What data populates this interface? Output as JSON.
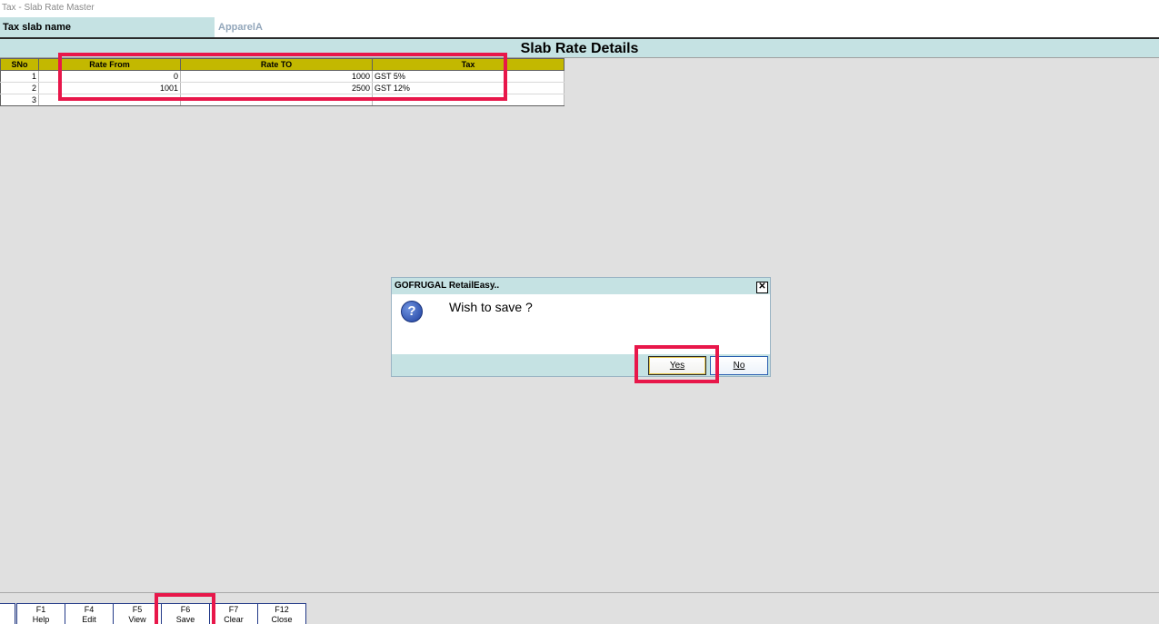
{
  "window": {
    "title": "Tax - Slab Rate Master"
  },
  "slab": {
    "label": "Tax slab name",
    "value": "ApparelA"
  },
  "section": {
    "title": "Slab Rate Details"
  },
  "grid": {
    "headers": {
      "sno": "SNo",
      "rate_from": "Rate From",
      "rate_to": "Rate TO",
      "tax": "Tax"
    },
    "rows": [
      {
        "sno": "1",
        "rate_from": "0",
        "rate_to": "1000",
        "tax": "GST 5%"
      },
      {
        "sno": "2",
        "rate_from": "1001",
        "rate_to": "2500",
        "tax": "GST 12%"
      },
      {
        "sno": "3",
        "rate_from": "",
        "rate_to": "",
        "tax": ""
      }
    ]
  },
  "dialog": {
    "title": "GOFRUGAL RetailEasy..",
    "close_glyph": "✕",
    "icon": "question-icon",
    "icon_glyph": "?",
    "message": "Wish to save ?",
    "yes_label": "Yes",
    "no_label": "No"
  },
  "fkeys": [
    {
      "key": "F1",
      "label": "Help"
    },
    {
      "key": "F4",
      "label": "Edit"
    },
    {
      "key": "F5",
      "label": "View"
    },
    {
      "key": "F6",
      "label": "Save"
    },
    {
      "key": "F7",
      "label": "Clear"
    },
    {
      "key": "F12",
      "label": "Close"
    }
  ],
  "colors": {
    "accent_teal": "#c5e2e3",
    "grid_header": "#c3b800",
    "highlight": "#e8174a",
    "background": "#e0e0e0"
  }
}
